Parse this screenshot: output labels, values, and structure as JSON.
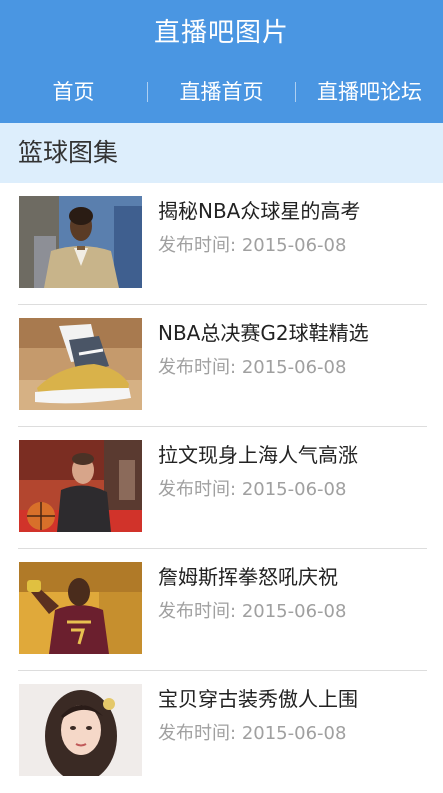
{
  "header": {
    "title": "直播吧图片",
    "background_color": "#4a96e2"
  },
  "nav": {
    "items": [
      {
        "label": "首页"
      },
      {
        "label": "直播首页"
      },
      {
        "label": "直播吧论坛"
      }
    ]
  },
  "section": {
    "title": "篮球图集",
    "background_color": "#ddeefc"
  },
  "articles": [
    {
      "title": "揭秘NBA众球星的高考",
      "date_label": "发布时间:",
      "date": "2015-06-08",
      "thumbnail": "player-in-suit-photo"
    },
    {
      "title": "NBA总决赛G2球鞋精选",
      "date_label": "发布时间:",
      "date": "2015-06-08",
      "thumbnail": "sneaker-photo"
    },
    {
      "title": "拉文现身上海人气高涨",
      "date_label": "发布时间:",
      "date": "2015-06-08",
      "thumbnail": "player-with-basketball-photo"
    },
    {
      "title": "詹姆斯挥拳怒吼庆祝",
      "date_label": "发布时间:",
      "date": "2015-06-08",
      "thumbnail": "player-celebrating-photo"
    },
    {
      "title": "宝贝穿古装秀傲人上围",
      "date_label": "发布时间:",
      "date": "2015-06-08",
      "thumbnail": "woman-portrait-photo"
    }
  ]
}
